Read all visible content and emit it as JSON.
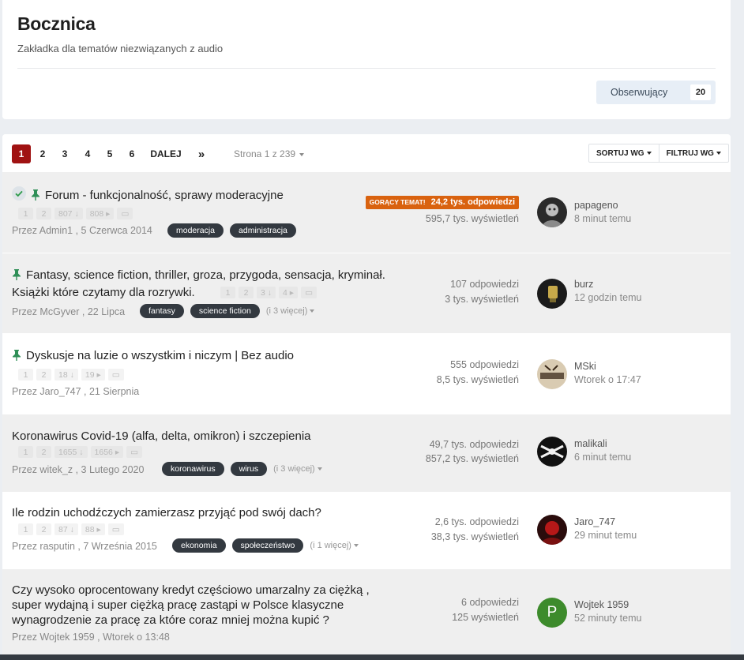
{
  "forum": {
    "title": "Bocznica",
    "description": "Zakładka dla tematów niezwiązanych z audio",
    "follow_label": "Obserwujący",
    "follow_count": "20"
  },
  "pagination": {
    "current": "1",
    "pages": [
      "2",
      "3",
      "4",
      "5",
      "6"
    ],
    "next_label": "DALEJ",
    "last_label": "»",
    "info": "Strona 1 z 239",
    "sort_label": "SORTUJ WG",
    "filter_label": "FILTRUJ WG"
  },
  "colors": {
    "accent": "#a01212",
    "hot": "#d9620f",
    "tag": "#333940"
  },
  "topics": [
    {
      "title": "Forum - funkcjonalność, sprawy moderacyjne",
      "icons": [
        "check-icon",
        "pin-icon"
      ],
      "pages": [
        "1",
        "2",
        "807",
        "808"
      ],
      "author": "Przez Admin1 , 5 Czerwca 2014",
      "tags": [
        "moderacja",
        "administracja"
      ],
      "more": "",
      "hot_label": "GORĄCY TEMAT!",
      "replies": "24,2 tys. odpowiedzi",
      "views": "595,7 tys. wyświetleń",
      "last_user": "papageno",
      "last_time": "8 minut temu"
    },
    {
      "title_1": "Fantasy, science fiction, thriller, groza, przygoda, sensacja, kryminał.",
      "title_2": "Książki które czytamy dla rozrywki.",
      "icons": [
        "pin-icon"
      ],
      "pages": [
        "1",
        "2",
        "3",
        "4"
      ],
      "author": "Przez McGyver , 22 Lipca",
      "tags": [
        "fantasy",
        "science fiction"
      ],
      "more": "(i 3 więcej)",
      "replies": "107 odpowiedzi",
      "views": "3 tys. wyświetleń",
      "last_user": "burz",
      "last_time": "12 godzin temu"
    },
    {
      "title": "Dyskusje na luzie o wszystkim i niczym | Bez audio",
      "icons": [
        "pin-icon"
      ],
      "pages": [
        "1",
        "2",
        "18",
        "19"
      ],
      "author": "Przez Jaro_747 , 21 Sierpnia",
      "tags": [],
      "more": "",
      "replies": "555 odpowiedzi",
      "views": "8,5 tys. wyświetleń",
      "last_user": "MSki",
      "last_time": "Wtorek o 17:47"
    },
    {
      "title": "Koronawirus Covid-19 (alfa, delta, omikron) i szczepienia",
      "icons": [],
      "pages": [
        "1",
        "2",
        "1655",
        "1656"
      ],
      "author": "Przez witek_z , 3 Lutego 2020",
      "tags": [
        "koronawirus",
        "wirus"
      ],
      "more": "(i 3 więcej)",
      "replies": "49,7 tys. odpowiedzi",
      "views": "857,2 tys. wyświetleń",
      "last_user": "malikali",
      "last_time": "6 minut temu"
    },
    {
      "title": "Ile rodzin uchodźczych zamierzasz przyjąć pod swój dach?",
      "icons": [],
      "pages": [
        "1",
        "2",
        "87",
        "88"
      ],
      "author": "Przez rasputin , 7 Września 2015",
      "tags": [
        "ekonomia",
        "społeczeństwo"
      ],
      "more": "(i 1 więcej)",
      "replies": "2,6 tys. odpowiedzi",
      "views": "38,3 tys. wyświetleń",
      "last_user": "Jaro_747",
      "last_time": "29 minut temu"
    },
    {
      "title_1": "Czy wysoko oprocentowany kredyt częściowo umarzalny za ciężką ,",
      "title_2": "super wydajną i super ciężką pracę zastąpi w Polsce klasyczne",
      "title_3": "wynagrodzenie za pracę za które coraz mniej można kupić ?",
      "icons": [],
      "pages": [],
      "author": "Przez Wojtek 1959 , Wtorek o 13:48",
      "tags": [],
      "more": "",
      "replies": "6 odpowiedzi",
      "views": "125 wyświetleń",
      "last_user": "Wojtek 1959",
      "last_time": "52 minuty temu",
      "avatar_letter": "P"
    }
  ]
}
